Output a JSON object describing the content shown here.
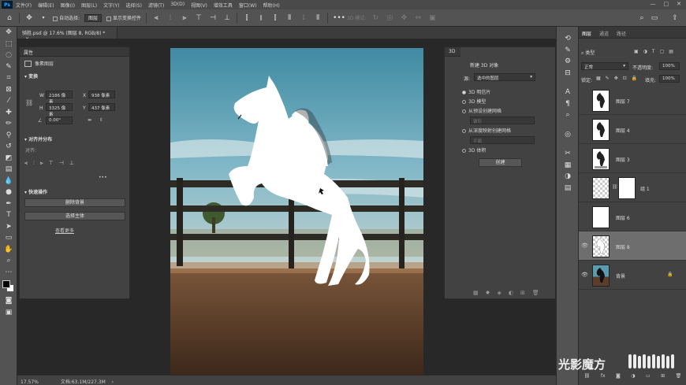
{
  "app_logo": "Ps",
  "menus": [
    "文件(F)",
    "编辑(E)",
    "图像(I)",
    "图层(L)",
    "文字(Y)",
    "选择(S)",
    "滤镜(T)",
    "3D(D)",
    "视图(V)",
    "增效工具",
    "窗口(W)",
    "帮助(H)"
  ],
  "window_controls": [
    "—",
    "□",
    "✕"
  ],
  "options_bar": {
    "auto_select_label": "自动选择:",
    "auto_select_value": "图层",
    "show_transform_label": "显示变换控件",
    "mode_3d_label": "3D 模式:"
  },
  "document_tab": {
    "title": "骑胜.psd @ 17.6% (图层 8, RGB/8) *",
    "close": "×"
  },
  "properties": {
    "tab": "属性",
    "type_label": "像素图层",
    "transform_header": "变换",
    "w_label": "W",
    "w_value": "2186 像素",
    "h_label": "H",
    "h_value": "3325 像素",
    "x_label": "X",
    "x_value": "938 像素",
    "y_label": "Y",
    "y_value": "437 像素",
    "angle_value": "0.00°",
    "align_header": "对齐并分布",
    "align_sub": "对齐:",
    "more_dots": "•••",
    "quick_header": "快速操作",
    "remove_bg": "删除背景",
    "select_subject": "选择主体",
    "learn_more": "查看更多"
  },
  "panel_3d": {
    "tab": "3D",
    "title": "新建 3D 对象",
    "source_label": "源:",
    "source_value": "选中的图层",
    "options": [
      "3D 明信片",
      "3D 模型",
      "从预设创建网格",
      "从深度映射创建网格",
      "3D 体积"
    ],
    "preset_placeholder": "锥形",
    "depth_placeholder": "平面",
    "create_button": "创建"
  },
  "layers_panel": {
    "tabs": [
      "图层",
      "通道",
      "路径"
    ],
    "filter_label": "类型",
    "blend_mode": "正常",
    "opacity_label": "不透明度:",
    "opacity_value": "100%",
    "lock_label": "锁定:",
    "fill_label": "填充:",
    "fill_value": "100%",
    "layers": [
      {
        "name": "图层 7",
        "visible": false,
        "thumb": "horse-dark"
      },
      {
        "name": "图层 4",
        "visible": false,
        "thumb": "horse-dark"
      },
      {
        "name": "图层 3",
        "visible": false,
        "thumb": "horse-dark"
      },
      {
        "name": "组 1",
        "visible": false,
        "thumb": "group"
      },
      {
        "name": "图层 6",
        "visible": false,
        "thumb": "white"
      },
      {
        "name": "图层 8",
        "visible": true,
        "thumb": "horse-white",
        "selected": true
      },
      {
        "name": "背景",
        "visible": true,
        "thumb": "photo",
        "locked": true
      }
    ]
  },
  "status": {
    "zoom": "17.57%",
    "doc": "文档:63.1M/227.3M"
  },
  "watermark": "光影魔方",
  "colors": {
    "accent": "#31a8ff",
    "sky": "#5a9bb0",
    "dirt": "#5b3e2a"
  }
}
